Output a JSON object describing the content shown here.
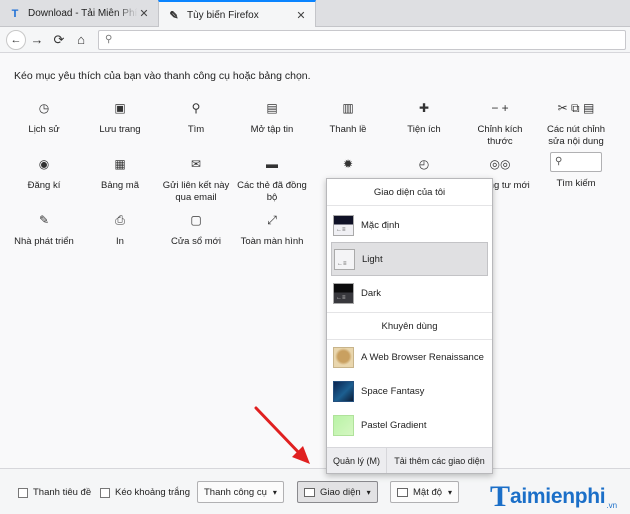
{
  "tabs": [
    {
      "icon": "T",
      "label": "Download - Tải Miễn Phí VN - Ph",
      "close": "✕"
    },
    {
      "icon": "✎",
      "label": "Tùy biến Firefox",
      "close": "✕"
    }
  ],
  "navbar": {
    "back": "←",
    "forward": "→",
    "reload": "⟳",
    "home": "⌂",
    "url_icon": "⚲"
  },
  "instructions": "Kéo mục yêu thích của bạn vào thanh công cụ hoặc bảng chọn.",
  "palette": [
    {
      "icon": "◷",
      "label": "Lịch sử"
    },
    {
      "icon": "▣",
      "label": "Lưu trang"
    },
    {
      "icon": "⚲",
      "label": "Tìm"
    },
    {
      "icon": "▤",
      "label": "Mở tập tin"
    },
    {
      "icon": "▥",
      "label": "Thanh lề"
    },
    {
      "icon": "✚",
      "label": "Tiện ích"
    },
    {
      "icon": "−  +",
      "label": "Chỉnh kích thước"
    },
    {
      "icon": "✂ ⧉ ▤",
      "label": "Các nút chỉnh sửa nội dung"
    },
    {
      "icon": "◉",
      "label": "Đăng kí"
    },
    {
      "icon": "▦",
      "label": "Bảng mã"
    },
    {
      "icon": "✉",
      "label": "Gửi liên kết này qua email"
    },
    {
      "icon": "▬",
      "label": "Các thẻ đã đồng bộ"
    },
    {
      "icon": "✹",
      "label": ""
    },
    {
      "icon": "◴",
      "label": ""
    },
    {
      "icon": "◎◎",
      "label": "ổ riêng tư mới"
    },
    {
      "icon": "⚲",
      "label": "Tìm kiếm"
    },
    {
      "icon": "✎",
      "label": "Nhà phát triển"
    },
    {
      "icon": "⎙",
      "label": "In"
    },
    {
      "icon": "▢",
      "label": "Cửa sổ mới"
    },
    {
      "icon": "⤢",
      "label": "Toàn màn hình"
    }
  ],
  "popup": {
    "my_themes_heading": "Giao diện của tôi",
    "my_themes": [
      {
        "label": "Mặc định",
        "thumb": "default",
        "selected": false
      },
      {
        "label": "Light",
        "thumb": "light",
        "selected": true
      },
      {
        "label": "Dark",
        "thumb": "dark",
        "selected": false
      }
    ],
    "recommended_heading": "Khuyên dùng",
    "recommended": [
      {
        "label": "A Web Browser Renaissance",
        "thumb": "renaissance"
      },
      {
        "label": "Space Fantasy",
        "thumb": "space"
      },
      {
        "label": "Pastel Gradient",
        "thumb": "pastel"
      }
    ],
    "manage": "Quản lý (M)",
    "get_more": "Tải thêm các giao diện"
  },
  "bottombar": {
    "title_bar": "Thanh tiêu đề",
    "drag_space": "Kéo khoảng trắng",
    "toolbars": "Thanh công cụ",
    "themes": "Giao diện",
    "density": "Mật độ",
    "caret": "▾"
  },
  "logo": {
    "t": "T",
    "rest": "aimienphi",
    "vn": ".vn"
  },
  "colors": {
    "accent": "#0a84ff",
    "arrow": "#e02020",
    "logo": "#1b6fc8"
  }
}
